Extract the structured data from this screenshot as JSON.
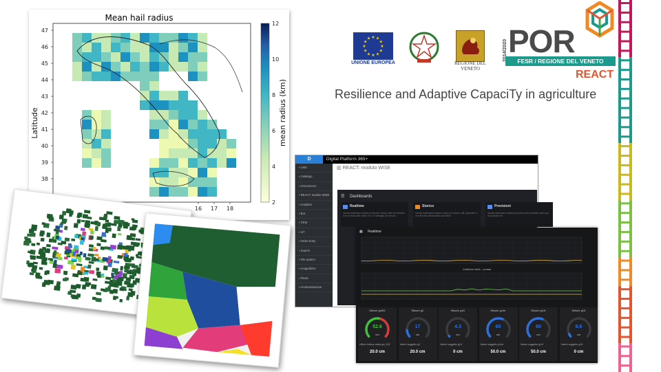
{
  "map": {
    "title": "Mean hail radius",
    "ylabel": "Latitude",
    "colorbar_label": "mean radius (km)",
    "y_ticks": [
      "47",
      "46",
      "45",
      "44",
      "43",
      "42",
      "41",
      "40",
      "39",
      "38",
      "37"
    ],
    "x_ticks": [
      "16",
      "17",
      "18"
    ],
    "colorbar_ticks": [
      "12",
      "10",
      "8",
      "6",
      "4",
      "2"
    ]
  },
  "header": {
    "eu_label": "UNIONE EUROPEA",
    "veneto_label": "REGIONE DEL VENETO",
    "por_logo": "POR",
    "por_years": "2014/2020",
    "por_band": "FESR / REGIONE DEL VENETO",
    "project": "REACT",
    "subtitle": "Resilience and Adaptive CapaciTy in agriculture"
  },
  "platform": {
    "title": "Digital Platform 365+",
    "breadcrumb": "REACT: modulo WISE",
    "sidebar": [
      "CMS",
      "Catalogo",
      "eCommerce",
      "REACT: modulo WISE",
      "Analytics",
      "Bot",
      "CRM",
      "IoT",
      "Order Entry",
      "Search",
      "File system",
      "Anagrafiche",
      "Flussi",
      "Amministrazione"
    ]
  },
  "dashboards": {
    "title": "Dashboards",
    "cards": [
      {
        "name": "Realtime",
        "desc": "Questa dashboard mostra le misure in tempo reale dei rilevatori con la media delle ultime 24 h e il dettaglio dei sensori."
      },
      {
        "name": "Storico",
        "desc": "Questa dashboard mostra lo storico di misure, tutti i parametri in un intervallo selezionabile dall'utente."
      },
      {
        "name": "Previsioni",
        "desc": "Questa dashboard mostra le previsioni dei parametri meteo per le prossime ore."
      }
    ]
  },
  "realtime": {
    "title": "Realtime",
    "chart1_title": "",
    "chart2_title": "Collettore stell1 - portata",
    "gauges": [
      {
        "title": "Misure guf02",
        "value": "52.6",
        "unit": "cm",
        "fraction": 0.53,
        "color": "#3fbf3f",
        "foot": "Ultimo lettura valida gu_002",
        "foot_value": "20.0 cm"
      },
      {
        "title": "Misure g2",
        "value": "17",
        "unit": "cm",
        "fraction": 0.17,
        "color": "#2e6fd8",
        "foot": "Valore soggetto g2",
        "foot_value": "20.0 cm"
      },
      {
        "title": "Misure g16",
        "value": "4.3",
        "unit": "cm",
        "fraction": 0.05,
        "color": "#2e6fd8",
        "foot": "Valore soggetto g16",
        "foot_value": "0 cm"
      },
      {
        "title": "Misure g14e",
        "value": "60",
        "unit": "cm",
        "fraction": 0.6,
        "color": "#2e6fd8",
        "foot": "Valore soggetto g14e",
        "foot_value": "50.0 cm"
      },
      {
        "title": "Misure g14f",
        "value": "60",
        "unit": "cm",
        "fraction": 0.6,
        "color": "#2e6fd8",
        "foot": "Valore soggetto g14f",
        "foot_value": "50.0 cm"
      },
      {
        "title": "Misure g15",
        "value": "8.6",
        "unit": "cm",
        "fraction": 0.09,
        "color": "#2e6fd8",
        "foot": "Valore soggetto g15",
        "foot_value": "0 cm"
      }
    ]
  }
}
